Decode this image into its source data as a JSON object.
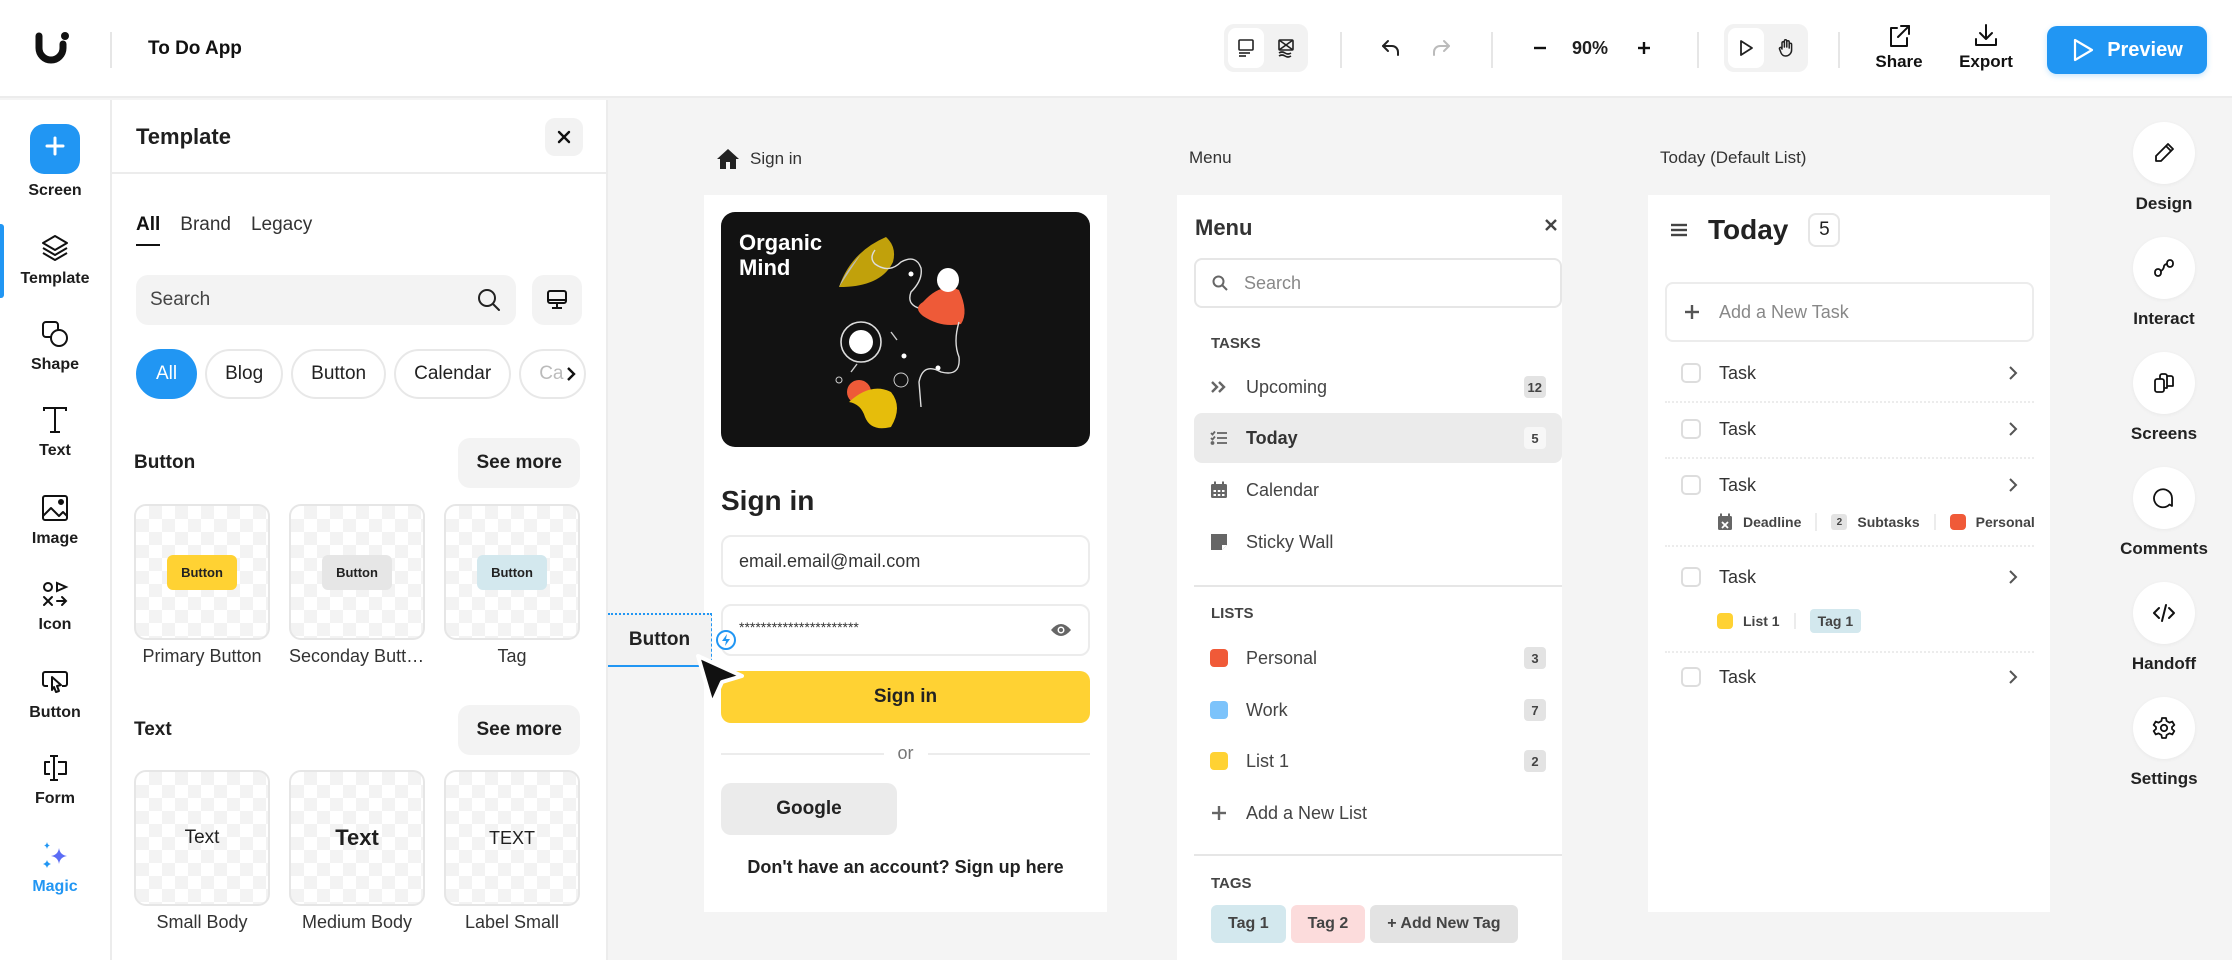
{
  "header": {
    "app_title": "To Do App",
    "zoom_level": "90%",
    "share_label": "Share",
    "export_label": "Export",
    "preview_label": "Preview",
    "accent_color": "#2196f3"
  },
  "left_rail": {
    "items": [
      {
        "label": "Screen",
        "icon": "plus-icon"
      },
      {
        "label": "Template",
        "icon": "layers-icon",
        "active": true
      },
      {
        "label": "Shape",
        "icon": "shape-icon"
      },
      {
        "label": "Text",
        "icon": "text-icon"
      },
      {
        "label": "Image",
        "icon": "image-icon"
      },
      {
        "label": "Icon",
        "icon": "icons-icon"
      },
      {
        "label": "Button",
        "icon": "button-cursor-icon"
      },
      {
        "label": "Form",
        "icon": "form-icon"
      },
      {
        "label": "Magic",
        "icon": "sparkle-icon"
      }
    ]
  },
  "template_panel": {
    "title": "Template",
    "tabs": [
      "All",
      "Brand",
      "Legacy"
    ],
    "active_tab": "All",
    "search_placeholder": "Search",
    "chips": [
      "All",
      "Blog",
      "Button",
      "Calendar",
      "Ca"
    ],
    "active_chip": "All",
    "sections": [
      {
        "title": "Button",
        "see_more": "See more",
        "cards": [
          {
            "preview": "Button",
            "label": "Primary Button",
            "color": "#ffd233"
          },
          {
            "preview": "Button",
            "label": "Seconday Button",
            "color": "#e6e6e6"
          },
          {
            "preview": "Button",
            "label": "Tag",
            "color": "#d3e8ee"
          }
        ]
      },
      {
        "title": "Text",
        "see_more": "See more",
        "cards": [
          {
            "preview": "Text",
            "label": "Small Body"
          },
          {
            "preview": "Text",
            "label": "Medium Body"
          },
          {
            "preview": "TEXT",
            "label": "Label Small"
          }
        ]
      }
    ]
  },
  "canvas": {
    "drag_element_label": "Button",
    "signin_screen": {
      "frame_label": "Sign in",
      "hero_text_line1": "Organic",
      "hero_text_line2": "Mind",
      "title": "Sign in",
      "email_value": "email.email@mail.com",
      "password_value": "**********************",
      "signin_button": "Sign in",
      "or_label": "or",
      "google_button": "Google",
      "signup_text": "Don't have an account? Sign up here"
    },
    "menu_screen": {
      "frame_label": "Menu",
      "title": "Menu",
      "search_placeholder": "Search",
      "tasks_heading": "TASKS",
      "tasks": [
        {
          "label": "Upcoming",
          "icon": "double-chevron-icon",
          "count": "12"
        },
        {
          "label": "Today",
          "icon": "checklist-icon",
          "count": "5",
          "active": true
        },
        {
          "label": "Calendar",
          "icon": "calendar-icon",
          "count": ""
        },
        {
          "label": "Sticky Wall",
          "icon": "sticky-note-icon",
          "count": ""
        }
      ],
      "lists_heading": "LISTS",
      "lists": [
        {
          "label": "Personal",
          "color": "#f05a38",
          "count": "3"
        },
        {
          "label": "Work",
          "color": "#7cc3fb",
          "count": "7"
        },
        {
          "label": "List 1",
          "color": "#ffd233",
          "count": "2"
        }
      ],
      "add_list_label": "Add a New List",
      "tags_heading": "TAGS",
      "tags": [
        {
          "label": "Tag 1",
          "color": "#d3e8ee"
        },
        {
          "label": "Tag 2",
          "color": "#fcdcdc"
        },
        {
          "label": "+ Add New Tag",
          "color": "#e3e3e3"
        }
      ]
    },
    "today_screen": {
      "frame_label": "Today (Default List)",
      "title": "Today",
      "count": "5",
      "add_task_placeholder": "Add a New Task",
      "tasks": [
        {
          "label": "Task"
        },
        {
          "label": "Task"
        },
        {
          "label": "Task",
          "meta": {
            "deadline": "Deadline",
            "subtasks_count": "2",
            "subtasks_label": "Subtasks",
            "list": "Personal",
            "list_color": "#f05a38"
          }
        },
        {
          "label": "Task",
          "meta": {
            "list": "List 1",
            "list_color": "#ffd233",
            "tag": "Tag 1"
          }
        },
        {
          "label": "Task"
        }
      ]
    }
  },
  "right_rail": {
    "items": [
      {
        "label": "Design",
        "icon": "pencil-icon"
      },
      {
        "label": "Interact",
        "icon": "interact-icon"
      },
      {
        "label": "Screens",
        "icon": "screens-icon"
      },
      {
        "label": "Comments",
        "icon": "comment-icon"
      },
      {
        "label": "Handoff",
        "icon": "code-icon"
      },
      {
        "label": "Settings",
        "icon": "settings-icon"
      }
    ]
  }
}
